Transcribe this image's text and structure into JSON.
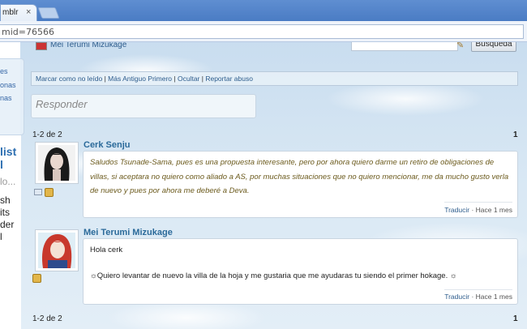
{
  "browser": {
    "tab_title": "mblr",
    "tab_close": "×",
    "url": "mid=76566"
  },
  "left_column": {
    "nav_items": [
      "es",
      "onas",
      "nas"
    ],
    "promo_lines": [
      "list",
      "l",
      "lo...",
      "sh",
      "its",
      "der",
      "l"
    ]
  },
  "topbar": {
    "username": "Mei Terumi Mizukage",
    "search_button": "Búsqueda"
  },
  "actions": {
    "mark_unread": "Marcar como no leído",
    "oldest_first": "Más Antiguo Primero",
    "hide": "Ocultar",
    "report": "Reportar abuso",
    "separator": " | "
  },
  "reply": {
    "placeholder": "Responder"
  },
  "pagination": {
    "range": "1-2 de 2",
    "page": "1"
  },
  "posts": [
    {
      "author": "Cerk Senju",
      "text": "Saludos Tsunade-Sama, pues es una propuesta interesante, pero por ahora quiero darme un retiro de obligaciones de villas, si aceptara no quiero como aliado a AS, por muchas situaciones que no quiero mencionar, me da mucho gusto verla de nuevo y pues por ahora me deberé a Deva.",
      "translate": "Traducir",
      "time": "Hace 1 mes"
    },
    {
      "author": "Mei Terumi Mizukage",
      "line1": "Hola cerk",
      "line2": "☼Quiero levantar de nuevo la villa de la hoja y me gustaria que me ayudaras tu siendo el primer hokage. ☼",
      "translate": "Traducir",
      "time": "Hace 1 mes"
    }
  ],
  "colors": {
    "link": "#2b6a9a",
    "browser_frame": "#4a7cc4",
    "italic_text": "#6c5b1e"
  }
}
